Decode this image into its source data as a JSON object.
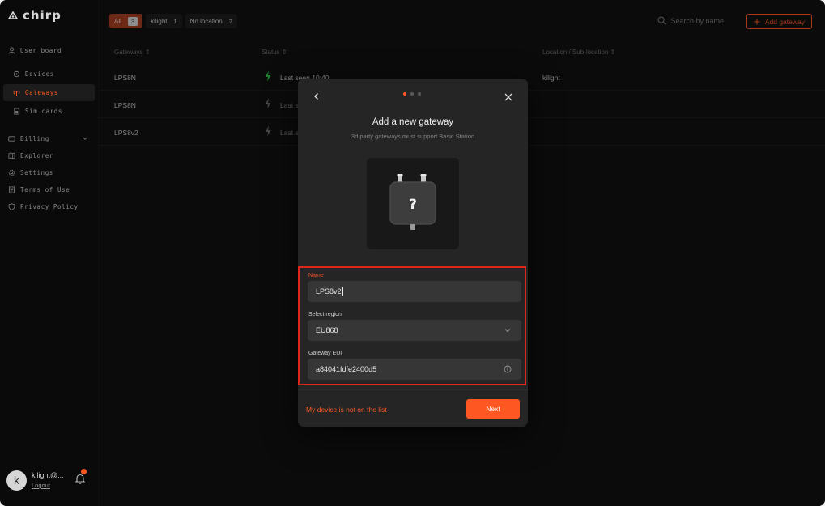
{
  "app": {
    "logo_text": "chirp",
    "accent": "#ff5722"
  },
  "sidebar": {
    "items": [
      {
        "label": "User board",
        "icon": "user-icon"
      },
      {
        "label": "Devices",
        "icon": "devices-icon"
      },
      {
        "label": "Gateways",
        "icon": "gateway-icon",
        "active": true
      },
      {
        "label": "Sim cards",
        "icon": "sim-card-icon"
      },
      {
        "label": "Billing",
        "icon": "billing-icon"
      },
      {
        "label": "Explorer",
        "icon": "map-icon"
      },
      {
        "label": "Settings",
        "icon": "gear-icon"
      },
      {
        "label": "Terms of Use",
        "icon": "document-icon"
      },
      {
        "label": "Privacy Policy",
        "icon": "shield-icon"
      }
    ],
    "user": {
      "avatar_letter": "k",
      "name": "kilight@...",
      "logout_label": "Logout"
    }
  },
  "header": {
    "filters": [
      {
        "label": "All",
        "count": "3"
      },
      {
        "label": "kilight",
        "count": "1"
      },
      {
        "label": "No location",
        "count": "2"
      }
    ],
    "search_placeholder": "Search by name",
    "add_label": "Add gateway"
  },
  "table": {
    "columns": [
      "Gateways",
      "Status",
      "Location / Sub-location"
    ],
    "rows": [
      {
        "name": "LPS8N",
        "status": "Last seen 10:40",
        "location": "kilight"
      },
      {
        "name": "LPS8N",
        "status": "Last s",
        "location": ""
      },
      {
        "name": "LPS8v2",
        "status": "Last s",
        "location": ""
      }
    ]
  },
  "modal": {
    "title": "Add a new gateway",
    "subtitle": "3d party gateways must support Basic Station",
    "device_glyph": "?",
    "step": 1,
    "steps": 3,
    "name_label": "Name",
    "name_value": "LPS8v2",
    "region_label": "Select region",
    "region_value": "EU868",
    "eui_label": "Gateway EUI",
    "eui_value": "a84041fdfe2400d5",
    "alt_link": "My device is not on the list",
    "next_label": "Next"
  }
}
